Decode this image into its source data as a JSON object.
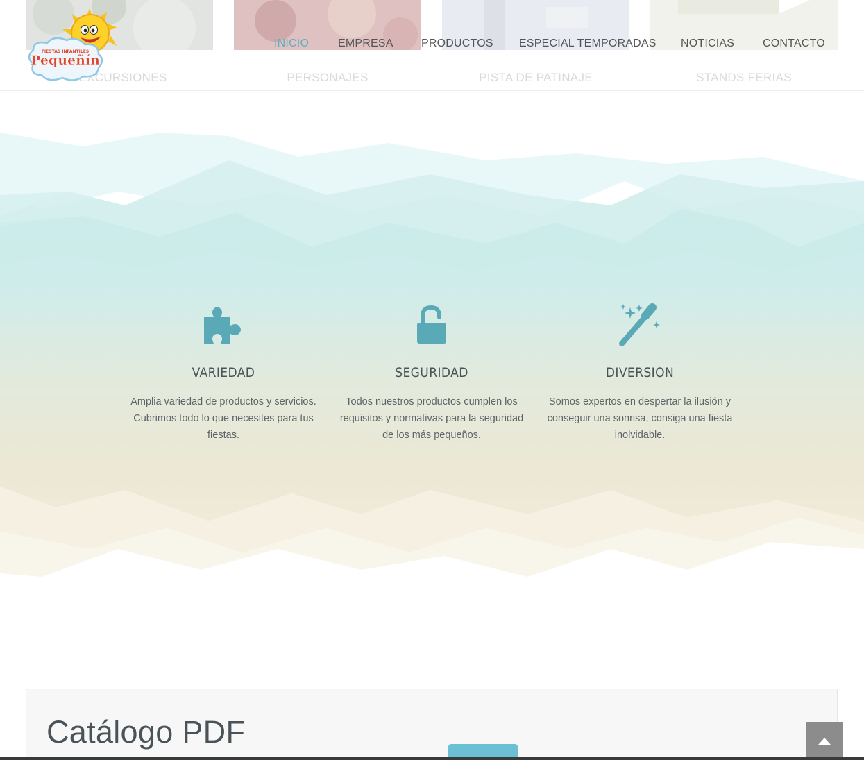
{
  "header": {
    "logo_text": "Pequeñín",
    "logo_tagline": "FIESTAS INFANTILES",
    "thumbnails": [
      {
        "caption": "EXCURSIONES"
      },
      {
        "caption": "PERSONAJES"
      },
      {
        "caption": "PISTA DE PATINAJE"
      },
      {
        "caption": "STANDS FERIAS"
      }
    ],
    "nav": [
      {
        "label": "INICIO",
        "active": true
      },
      {
        "label": "EMPRESA"
      },
      {
        "label": "PRODUCTOS"
      },
      {
        "label": "ESPECIAL TEMPORADAS"
      },
      {
        "label": "NOTICIAS"
      },
      {
        "label": "CONTACTO"
      }
    ]
  },
  "features": [
    {
      "icon": "puzzle-icon",
      "title": "VARIEDAD",
      "text": "Amplia variedad de productos y servicios. Cubrimos todo lo que necesites para tus fiestas."
    },
    {
      "icon": "unlock-icon",
      "title": "SEGURIDAD",
      "text": "Todos nuestros productos cumplen los requisitos y normativas para la seguridad de los más pequeños."
    },
    {
      "icon": "magic-wand-icon",
      "title": "DIVERSION",
      "text": "Somos expertos en despertar la ilusión y conseguir una sonrisa, consiga una fiesta inolvidable."
    }
  ],
  "catalog": {
    "title": "Catálogo PDF"
  },
  "colors": {
    "accent": "#5db0bd",
    "icon": "#5aa9b6",
    "text": "#4a5358",
    "button": "#6cc0d6",
    "scroll_top": "#8c8c8c"
  }
}
